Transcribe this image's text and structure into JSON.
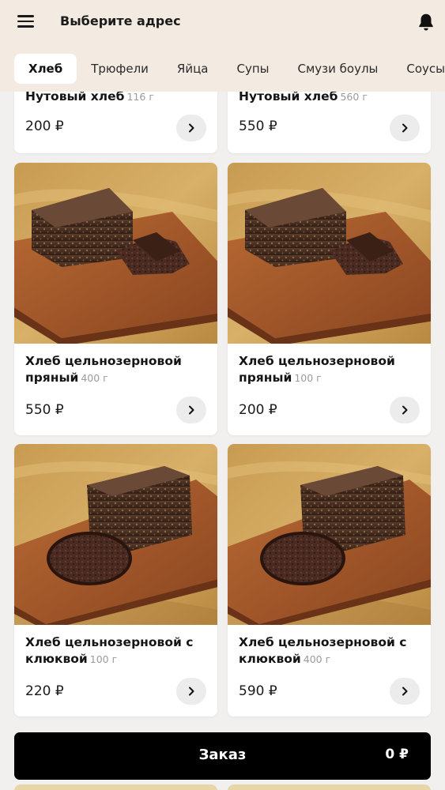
{
  "header": {
    "address_label": "Выберите адрес"
  },
  "categories": [
    "Хлеб",
    "Трюфели",
    "Яйца",
    "Супы",
    "Смузи боулы",
    "Соусы"
  ],
  "active_category": "Хлеб",
  "currency": "₽",
  "products": [
    {
      "name": "Нутовый хлеб",
      "weight": "116 г",
      "price": "200 ₽"
    },
    {
      "name": "Нутовый хлеб",
      "weight": "560 г",
      "price": "550 ₽"
    },
    {
      "name": "Хлеб цельнозерновой пряный",
      "weight": "400 г",
      "price": "550 ₽"
    },
    {
      "name": "Хлеб цельнозерновой пряный",
      "weight": "100 г",
      "price": "200 ₽"
    },
    {
      "name": "Хлеб цельнозерновой с клюквой",
      "weight": "100 г",
      "price": "220 ₽"
    },
    {
      "name": "Хлеб цельнозерновой с клюквой",
      "weight": "400 г",
      "price": "590 ₽"
    }
  ],
  "order_bar": {
    "label": "Заказ",
    "total": "0 ₽"
  },
  "icons": {
    "menu": "hamburger-menu-icon",
    "notifications": "bell-icon",
    "add": "chevron-right-icon"
  },
  "colors": {
    "header_bg": "#f3ebe1",
    "page_bg": "#f2f0ee",
    "order_bar_bg": "#000000",
    "weight_text": "#9b9b9b"
  }
}
